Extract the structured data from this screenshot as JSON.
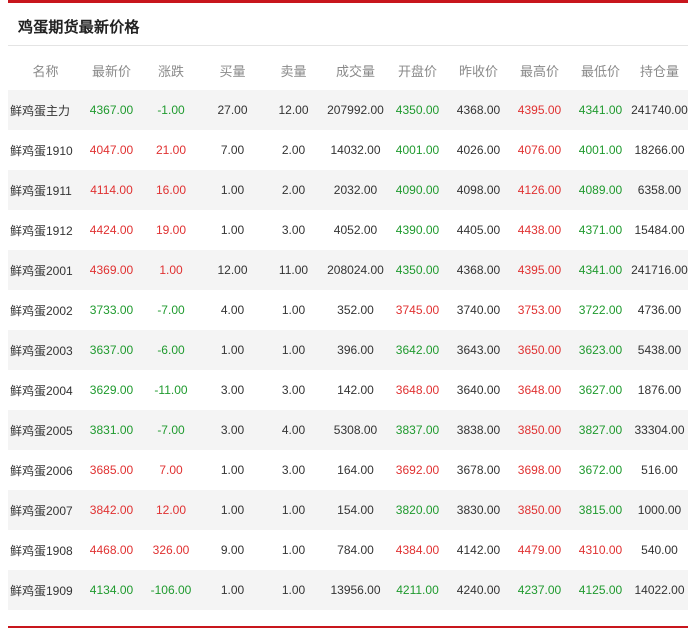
{
  "title": "鸡蛋期货最新价格",
  "watermark": "",
  "colors": {
    "accent": "#c8161d",
    "up": "#e03131",
    "down": "#1f9a2e",
    "header_text": "#8a8a8a"
  },
  "columns": [
    "名称",
    "最新价",
    "涨跌",
    "买量",
    "卖量",
    "成交量",
    "开盘价",
    "昨收价",
    "最高价",
    "最低价",
    "持仓量"
  ],
  "rows": [
    {
      "name": "鲜鸡蛋主力",
      "last": "4367.00",
      "change": "-1.00",
      "bid": "27.00",
      "ask": "12.00",
      "volume": "207992.00",
      "open": "4350.00",
      "prev": "4368.00",
      "high": "4395.00",
      "low": "4341.00",
      "oi": "241740.00",
      "c": {
        "last": "down",
        "change": "down",
        "open": "down",
        "high": "up",
        "low": "down"
      }
    },
    {
      "name": "鲜鸡蛋1910",
      "last": "4047.00",
      "change": "21.00",
      "bid": "7.00",
      "ask": "2.00",
      "volume": "14032.00",
      "open": "4001.00",
      "prev": "4026.00",
      "high": "4076.00",
      "low": "4001.00",
      "oi": "18266.00",
      "c": {
        "last": "up",
        "change": "up",
        "open": "down",
        "high": "up",
        "low": "down"
      }
    },
    {
      "name": "鲜鸡蛋1911",
      "last": "4114.00",
      "change": "16.00",
      "bid": "1.00",
      "ask": "2.00",
      "volume": "2032.00",
      "open": "4090.00",
      "prev": "4098.00",
      "high": "4126.00",
      "low": "4089.00",
      "oi": "6358.00",
      "c": {
        "last": "up",
        "change": "up",
        "open": "down",
        "high": "up",
        "low": "down"
      }
    },
    {
      "name": "鲜鸡蛋1912",
      "last": "4424.00",
      "change": "19.00",
      "bid": "1.00",
      "ask": "3.00",
      "volume": "4052.00",
      "open": "4390.00",
      "prev": "4405.00",
      "high": "4438.00",
      "low": "4371.00",
      "oi": "15484.00",
      "c": {
        "last": "up",
        "change": "up",
        "open": "down",
        "high": "up",
        "low": "down"
      }
    },
    {
      "name": "鲜鸡蛋2001",
      "last": "4369.00",
      "change": "1.00",
      "bid": "12.00",
      "ask": "11.00",
      "volume": "208024.00",
      "open": "4350.00",
      "prev": "4368.00",
      "high": "4395.00",
      "low": "4341.00",
      "oi": "241716.00",
      "c": {
        "last": "up",
        "change": "up",
        "open": "down",
        "high": "up",
        "low": "down"
      }
    },
    {
      "name": "鲜鸡蛋2002",
      "last": "3733.00",
      "change": "-7.00",
      "bid": "4.00",
      "ask": "1.00",
      "volume": "352.00",
      "open": "3745.00",
      "prev": "3740.00",
      "high": "3753.00",
      "low": "3722.00",
      "oi": "4736.00",
      "c": {
        "last": "down",
        "change": "down",
        "open": "up",
        "high": "up",
        "low": "down"
      }
    },
    {
      "name": "鲜鸡蛋2003",
      "last": "3637.00",
      "change": "-6.00",
      "bid": "1.00",
      "ask": "1.00",
      "volume": "396.00",
      "open": "3642.00",
      "prev": "3643.00",
      "high": "3650.00",
      "low": "3623.00",
      "oi": "5438.00",
      "c": {
        "last": "down",
        "change": "down",
        "open": "down",
        "high": "up",
        "low": "down"
      }
    },
    {
      "name": "鲜鸡蛋2004",
      "last": "3629.00",
      "change": "-11.00",
      "bid": "3.00",
      "ask": "3.00",
      "volume": "142.00",
      "open": "3648.00",
      "prev": "3640.00",
      "high": "3648.00",
      "low": "3627.00",
      "oi": "1876.00",
      "c": {
        "last": "down",
        "change": "down",
        "open": "up",
        "high": "up",
        "low": "down"
      }
    },
    {
      "name": "鲜鸡蛋2005",
      "last": "3831.00",
      "change": "-7.00",
      "bid": "3.00",
      "ask": "4.00",
      "volume": "5308.00",
      "open": "3837.00",
      "prev": "3838.00",
      "high": "3850.00",
      "low": "3827.00",
      "oi": "33304.00",
      "c": {
        "last": "down",
        "change": "down",
        "open": "down",
        "high": "up",
        "low": "down"
      }
    },
    {
      "name": "鲜鸡蛋2006",
      "last": "3685.00",
      "change": "7.00",
      "bid": "1.00",
      "ask": "3.00",
      "volume": "164.00",
      "open": "3692.00",
      "prev": "3678.00",
      "high": "3698.00",
      "low": "3672.00",
      "oi": "516.00",
      "c": {
        "last": "up",
        "change": "up",
        "open": "up",
        "high": "up",
        "low": "down"
      }
    },
    {
      "name": "鲜鸡蛋2007",
      "last": "3842.00",
      "change": "12.00",
      "bid": "1.00",
      "ask": "1.00",
      "volume": "154.00",
      "open": "3820.00",
      "prev": "3830.00",
      "high": "3850.00",
      "low": "3815.00",
      "oi": "1000.00",
      "c": {
        "last": "up",
        "change": "up",
        "open": "down",
        "high": "up",
        "low": "down"
      }
    },
    {
      "name": "鲜鸡蛋1908",
      "last": "4468.00",
      "change": "326.00",
      "bid": "9.00",
      "ask": "1.00",
      "volume": "784.00",
      "open": "4384.00",
      "prev": "4142.00",
      "high": "4479.00",
      "low": "4310.00",
      "oi": "540.00",
      "c": {
        "last": "up",
        "change": "up",
        "open": "up",
        "high": "up",
        "low": "up"
      }
    },
    {
      "name": "鲜鸡蛋1909",
      "last": "4134.00",
      "change": "-106.00",
      "bid": "1.00",
      "ask": "1.00",
      "volume": "13956.00",
      "open": "4211.00",
      "prev": "4240.00",
      "high": "4237.00",
      "low": "4125.00",
      "oi": "14022.00",
      "c": {
        "last": "down",
        "change": "down",
        "open": "down",
        "high": "down",
        "low": "down"
      }
    }
  ]
}
